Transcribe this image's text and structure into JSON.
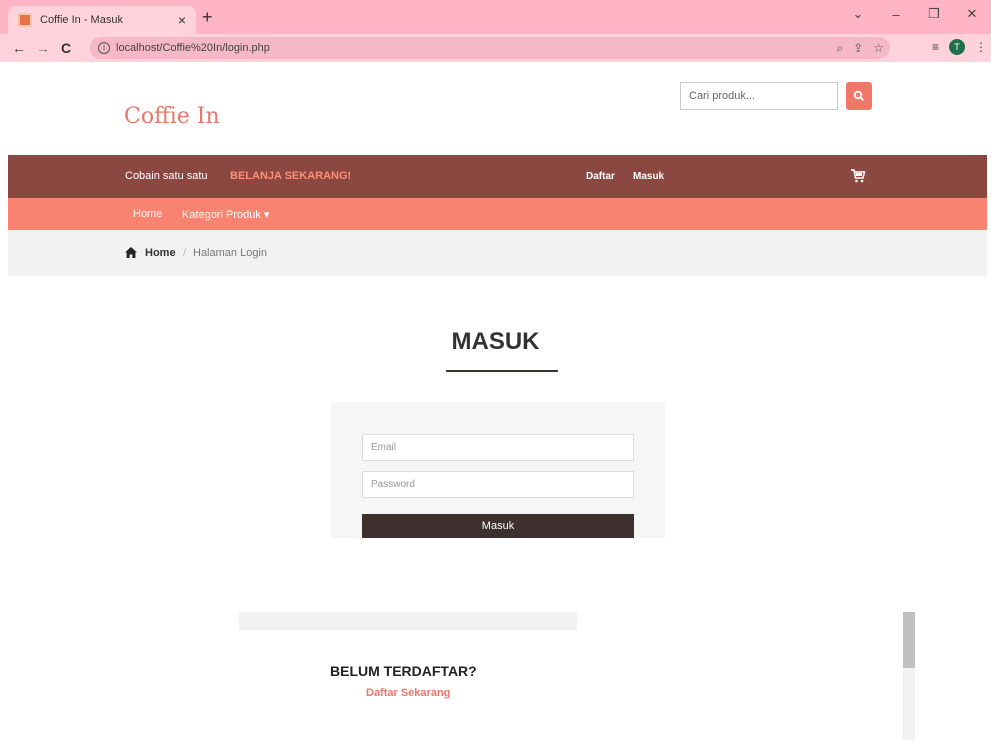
{
  "browser": {
    "tab_title": "Coffie In - Masuk",
    "tab_close": "×",
    "new_tab": "+",
    "url": "localhost/Coffie%20In/login.php",
    "profile_initial": "T",
    "win_min": "–",
    "win_restore": "❐",
    "win_close": "✕",
    "win_dropdown": "⌄"
  },
  "header": {
    "logo": "Coffie In",
    "search_placeholder": "Cari produk..."
  },
  "topbar": {
    "promo": "Cobain satu satu",
    "cta": "BELANJA SEKARANG!",
    "register": "Daftar",
    "login": "Masuk"
  },
  "menu": {
    "home": "Home",
    "category": "Kategori Produk ▾"
  },
  "breadcrumb": {
    "home": "Home",
    "separator": "/",
    "current": "Halaman Login"
  },
  "login": {
    "title": "MASUK",
    "email_placeholder": "Email",
    "password_placeholder": "Password",
    "submit": "Masuk"
  },
  "register_prompt": {
    "question": "BELUM TERDAFTAR?",
    "link": "Daftar Sekarang"
  },
  "colors": {
    "accent": "#f07869",
    "topbar": "#8a4840",
    "menubar": "#fa8270",
    "button_dark": "#3e302c",
    "browser_frame": "#ffb5c5"
  }
}
